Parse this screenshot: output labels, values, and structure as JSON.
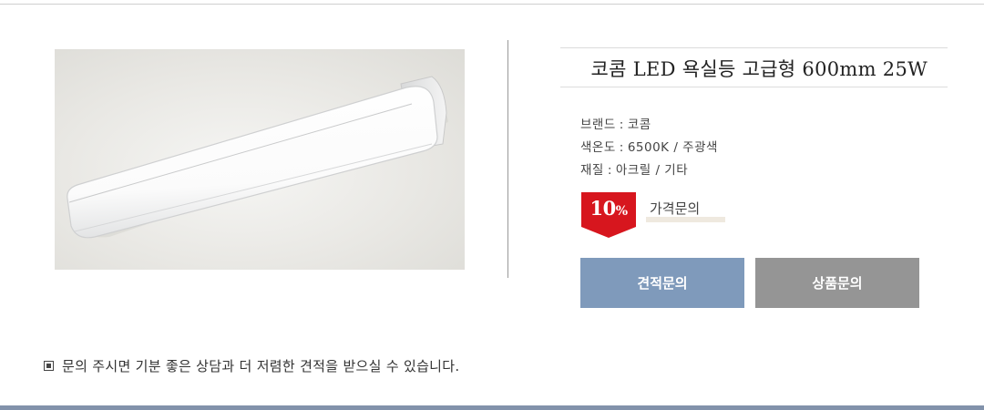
{
  "product": {
    "title": "코콤 LED 욕실등 고급형 600mm 25W",
    "image_alt": "LED 욕실등 제품 이미지"
  },
  "specs": [
    {
      "label": "브랜드",
      "value": "코콤"
    },
    {
      "label": "색온도",
      "value": "6500K / 주광색"
    },
    {
      "label": "재질",
      "value": "아크릴 / 기타"
    }
  ],
  "price": {
    "discount": "10",
    "discount_unit": "%",
    "text": "가격문의"
  },
  "buttons": {
    "quote_label": "견적문의",
    "inquiry_label": "상품문의"
  },
  "notice": {
    "text": "문의 주시면 기분 좋은 상담과 더 저렴한 견적을 받으실 수 있습니다."
  },
  "colors": {
    "quote_button": "#7f9abb",
    "inquiry_button": "#959595",
    "discount_badge": "#d7161e",
    "bottom_bar": "#8292ab"
  }
}
